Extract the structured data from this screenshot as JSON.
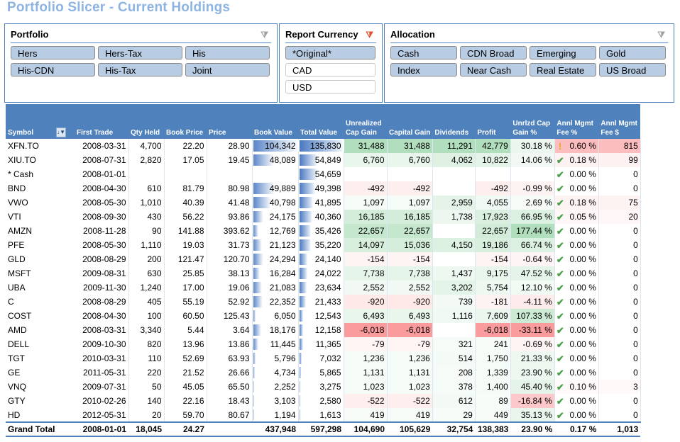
{
  "title": "Portfolio Slicer - Current Holdings",
  "slicers": {
    "portfolio": {
      "title": "Portfolio",
      "clear_filter_icon": "filter-clear-icon",
      "items": [
        {
          "label": "Hers",
          "selected": true
        },
        {
          "label": "Hers-Tax",
          "selected": true
        },
        {
          "label": "His",
          "selected": true
        },
        {
          "label": "His-CDN",
          "selected": true
        },
        {
          "label": "His-Tax",
          "selected": true
        },
        {
          "label": "Joint",
          "selected": true
        }
      ]
    },
    "currency": {
      "title": "Report Currency",
      "clear_filter_icon": "filter-clear-active-icon",
      "items": [
        {
          "label": "*Original*",
          "selected": true
        },
        {
          "label": "CAD",
          "selected": false
        },
        {
          "label": "USD",
          "selected": false
        }
      ]
    },
    "allocation": {
      "title": "Allocation",
      "clear_filter_icon": "filter-clear-icon",
      "items": [
        {
          "label": "Cash",
          "selected": true
        },
        {
          "label": "CDN Broad",
          "selected": true
        },
        {
          "label": "Emerging",
          "selected": true
        },
        {
          "label": "Gold",
          "selected": true
        },
        {
          "label": "Index",
          "selected": true
        },
        {
          "label": "Near Cash",
          "selected": true
        },
        {
          "label": "Real Estate",
          "selected": true
        },
        {
          "label": "US Broad",
          "selected": true
        }
      ]
    }
  },
  "table": {
    "columns": [
      "Symbol",
      "First Trade",
      "Qty Held",
      "Book Price",
      "Price",
      "Book Value",
      "Total Value",
      "Unrealized Cap Gain",
      "Capital Gain",
      "Dividends",
      "Profit",
      "Unrlzd Cap Gain %",
      "Annl Mgmt Fee %",
      "Annl Mgmt Fee $"
    ],
    "header_lines": [
      [
        "",
        "Symbol"
      ],
      [
        "",
        "First Trade"
      ],
      [
        "",
        "Qty Held"
      ],
      [
        "",
        "Book Price"
      ],
      [
        "",
        "Price"
      ],
      [
        "",
        "Book Value"
      ],
      [
        "",
        "Total Value"
      ],
      [
        "Unrealized",
        "Cap Gain"
      ],
      [
        "",
        "Capital Gain"
      ],
      [
        "",
        "Dividends"
      ],
      [
        "",
        "Profit"
      ],
      [
        "Unrlzd Cap",
        "Gain %"
      ],
      [
        "Annl Mgmt",
        "Fee %"
      ],
      [
        "Annl Mgmt",
        "Fee $"
      ]
    ],
    "sort_icon": "sort-filter-icon",
    "rows": [
      {
        "symbol": "XFN.TO",
        "first_trade": "2008-03-31",
        "qty": "4,700",
        "book_price": "22.20",
        "price": "28.90",
        "book_value": "104,342",
        "total_value": "135,830",
        "unrl_gain": "31,488",
        "cap_gain": "31,488",
        "dividends": "11,291",
        "profit": "42,779",
        "unrl_pct": "30.18 %",
        "fee_icon": "warning",
        "fee_pct": "0.60 %",
        "fee_amt": "815"
      },
      {
        "symbol": "XIU.TO",
        "first_trade": "2008-07-31",
        "qty": "2,820",
        "book_price": "17.05",
        "price": "19.45",
        "book_value": "48,089",
        "total_value": "54,849",
        "unrl_gain": "6,760",
        "cap_gain": "6,760",
        "dividends": "4,062",
        "profit": "10,822",
        "unrl_pct": "14.06 %",
        "fee_icon": "check",
        "fee_pct": "0.18 %",
        "fee_amt": "99"
      },
      {
        "symbol": "* Cash",
        "first_trade": "2008-01-01",
        "qty": "",
        "book_price": "",
        "price": "",
        "book_value": "",
        "total_value": "54,659",
        "unrl_gain": "",
        "cap_gain": "",
        "dividends": "",
        "profit": "",
        "unrl_pct": "",
        "fee_icon": "check",
        "fee_pct": "0.00 %",
        "fee_amt": "0"
      },
      {
        "symbol": "BND",
        "first_trade": "2008-04-30",
        "qty": "610",
        "book_price": "81.79",
        "price": "80.98",
        "book_value": "49,889",
        "total_value": "49,398",
        "unrl_gain": "-492",
        "cap_gain": "-492",
        "dividends": "",
        "profit": "-492",
        "unrl_pct": "-0.99 %",
        "fee_icon": "check",
        "fee_pct": "0.00 %",
        "fee_amt": "0"
      },
      {
        "symbol": "VWO",
        "first_trade": "2008-05-30",
        "qty": "1,010",
        "book_price": "40.39",
        "price": "41.48",
        "book_value": "40,798",
        "total_value": "41,895",
        "unrl_gain": "1,097",
        "cap_gain": "1,097",
        "dividends": "2,959",
        "profit": "4,055",
        "unrl_pct": "2.69 %",
        "fee_icon": "check",
        "fee_pct": "0.18 %",
        "fee_amt": "75"
      },
      {
        "symbol": "VTI",
        "first_trade": "2008-09-30",
        "qty": "430",
        "book_price": "56.22",
        "price": "93.86",
        "book_value": "24,175",
        "total_value": "40,360",
        "unrl_gain": "16,185",
        "cap_gain": "16,185",
        "dividends": "1,738",
        "profit": "17,923",
        "unrl_pct": "66.95 %",
        "fee_icon": "check",
        "fee_pct": "0.05 %",
        "fee_amt": "20"
      },
      {
        "symbol": "AMZN",
        "first_trade": "2008-11-28",
        "qty": "90",
        "book_price": "141.88",
        "price": "393.62",
        "book_value": "12,769",
        "total_value": "35,426",
        "unrl_gain": "22,657",
        "cap_gain": "22,657",
        "dividends": "",
        "profit": "22,657",
        "unrl_pct": "177.44 %",
        "fee_icon": "check",
        "fee_pct": "0.00 %",
        "fee_amt": "0"
      },
      {
        "symbol": "PFE",
        "first_trade": "2008-05-30",
        "qty": "1,110",
        "book_price": "19.03",
        "price": "31.73",
        "book_value": "21,123",
        "total_value": "35,220",
        "unrl_gain": "14,097",
        "cap_gain": "15,036",
        "dividends": "4,150",
        "profit": "19,186",
        "unrl_pct": "66.74 %",
        "fee_icon": "check",
        "fee_pct": "0.00 %",
        "fee_amt": "0"
      },
      {
        "symbol": "GLD",
        "first_trade": "2008-08-29",
        "qty": "200",
        "book_price": "121.47",
        "price": "120.70",
        "book_value": "24,294",
        "total_value": "24,140",
        "unrl_gain": "-154",
        "cap_gain": "-154",
        "dividends": "",
        "profit": "-154",
        "unrl_pct": "-0.64 %",
        "fee_icon": "check",
        "fee_pct": "0.00 %",
        "fee_amt": "0"
      },
      {
        "symbol": "MSFT",
        "first_trade": "2009-08-31",
        "qty": "630",
        "book_price": "25.85",
        "price": "38.13",
        "book_value": "16,284",
        "total_value": "24,022",
        "unrl_gain": "7,738",
        "cap_gain": "7,738",
        "dividends": "1,437",
        "profit": "9,175",
        "unrl_pct": "47.52 %",
        "fee_icon": "check",
        "fee_pct": "0.00 %",
        "fee_amt": "0"
      },
      {
        "symbol": "UBA",
        "first_trade": "2009-11-30",
        "qty": "1,240",
        "book_price": "17.00",
        "price": "19.06",
        "book_value": "21,083",
        "total_value": "23,634",
        "unrl_gain": "2,552",
        "cap_gain": "2,552",
        "dividends": "3,202",
        "profit": "5,754",
        "unrl_pct": "12.10 %",
        "fee_icon": "check",
        "fee_pct": "0.00 %",
        "fee_amt": "0"
      },
      {
        "symbol": "C",
        "first_trade": "2008-08-29",
        "qty": "405",
        "book_price": "55.19",
        "price": "52.92",
        "book_value": "22,352",
        "total_value": "21,433",
        "unrl_gain": "-920",
        "cap_gain": "-920",
        "dividends": "739",
        "profit": "-181",
        "unrl_pct": "-4.11 %",
        "fee_icon": "check",
        "fee_pct": "0.00 %",
        "fee_amt": "0"
      },
      {
        "symbol": "COST",
        "first_trade": "2008-04-30",
        "qty": "100",
        "book_price": "60.50",
        "price": "125.43",
        "book_value": "6,050",
        "total_value": "12,543",
        "unrl_gain": "6,493",
        "cap_gain": "6,493",
        "dividends": "1,116",
        "profit": "7,609",
        "unrl_pct": "107.33 %",
        "fee_icon": "check",
        "fee_pct": "0.00 %",
        "fee_amt": "0"
      },
      {
        "symbol": "AMD",
        "first_trade": "2008-03-31",
        "qty": "3,340",
        "book_price": "5.44",
        "price": "3.64",
        "book_value": "18,176",
        "total_value": "12,158",
        "unrl_gain": "-6,018",
        "cap_gain": "-6,018",
        "dividends": "",
        "profit": "-6,018",
        "unrl_pct": "-33.11 %",
        "fee_icon": "check",
        "fee_pct": "0.00 %",
        "fee_amt": "0"
      },
      {
        "symbol": "DELL",
        "first_trade": "2009-10-30",
        "qty": "820",
        "book_price": "13.96",
        "price": "13.86",
        "book_value": "11,445",
        "total_value": "11,365",
        "unrl_gain": "-79",
        "cap_gain": "-79",
        "dividends": "321",
        "profit": "241",
        "unrl_pct": "-0.69 %",
        "fee_icon": "check",
        "fee_pct": "0.00 %",
        "fee_amt": "0"
      },
      {
        "symbol": "TGT",
        "first_trade": "2010-03-31",
        "qty": "110",
        "book_price": "52.69",
        "price": "63.93",
        "book_value": "5,796",
        "total_value": "7,032",
        "unrl_gain": "1,236",
        "cap_gain": "1,236",
        "dividends": "514",
        "profit": "1,750",
        "unrl_pct": "21.33 %",
        "fee_icon": "check",
        "fee_pct": "0.00 %",
        "fee_amt": "0"
      },
      {
        "symbol": "GE",
        "first_trade": "2011-05-31",
        "qty": "220",
        "book_price": "21.52",
        "price": "26.66",
        "book_value": "4,734",
        "total_value": "5,865",
        "unrl_gain": "1,131",
        "cap_gain": "1,131",
        "dividends": "208",
        "profit": "1,339",
        "unrl_pct": "23.90 %",
        "fee_icon": "check",
        "fee_pct": "0.00 %",
        "fee_amt": "0"
      },
      {
        "symbol": "VNQ",
        "first_trade": "2009-07-31",
        "qty": "50",
        "book_price": "45.05",
        "price": "65.50",
        "book_value": "2,252",
        "total_value": "3,275",
        "unrl_gain": "1,023",
        "cap_gain": "1,023",
        "dividends": "378",
        "profit": "1,400",
        "unrl_pct": "45.40 %",
        "fee_icon": "check",
        "fee_pct": "0.10 %",
        "fee_amt": "3"
      },
      {
        "symbol": "GTY",
        "first_trade": "2010-02-26",
        "qty": "140",
        "book_price": "22.16",
        "price": "18.43",
        "book_value": "3,103",
        "total_value": "2,580",
        "unrl_gain": "-522",
        "cap_gain": "-522",
        "dividends": "612",
        "profit": "89",
        "unrl_pct": "-16.84 %",
        "fee_icon": "check",
        "fee_pct": "0.00 %",
        "fee_amt": "0"
      },
      {
        "symbol": "HD",
        "first_trade": "2012-05-31",
        "qty": "20",
        "book_price": "59.70",
        "price": "80.67",
        "book_value": "1,194",
        "total_value": "1,613",
        "unrl_gain": "419",
        "cap_gain": "419",
        "dividends": "29",
        "profit": "449",
        "unrl_pct": "35.13 %",
        "fee_icon": "check",
        "fee_pct": "0.00 %",
        "fee_amt": "0"
      }
    ],
    "total": {
      "symbol": "Grand Total",
      "first_trade": "2008-01-01",
      "qty": "18,045",
      "book_price": "24.27",
      "price": "",
      "book_value": "437,948",
      "total_value": "597,298",
      "unrl_gain": "104,690",
      "cap_gain": "105,629",
      "dividends": "32,754",
      "profit": "138,383",
      "unrl_pct": "23.90 %",
      "fee_pct": "0.17 %",
      "fee_amt": "1,013"
    }
  },
  "colors": {
    "header_bg": "#4f81bd",
    "title": "#8db4e2",
    "slicer_selected": "#b8cce4",
    "positive_scale": "#63be7b",
    "negative_scale": "#f8696b",
    "check": "#4aa04a",
    "warning": "#f0a020"
  }
}
